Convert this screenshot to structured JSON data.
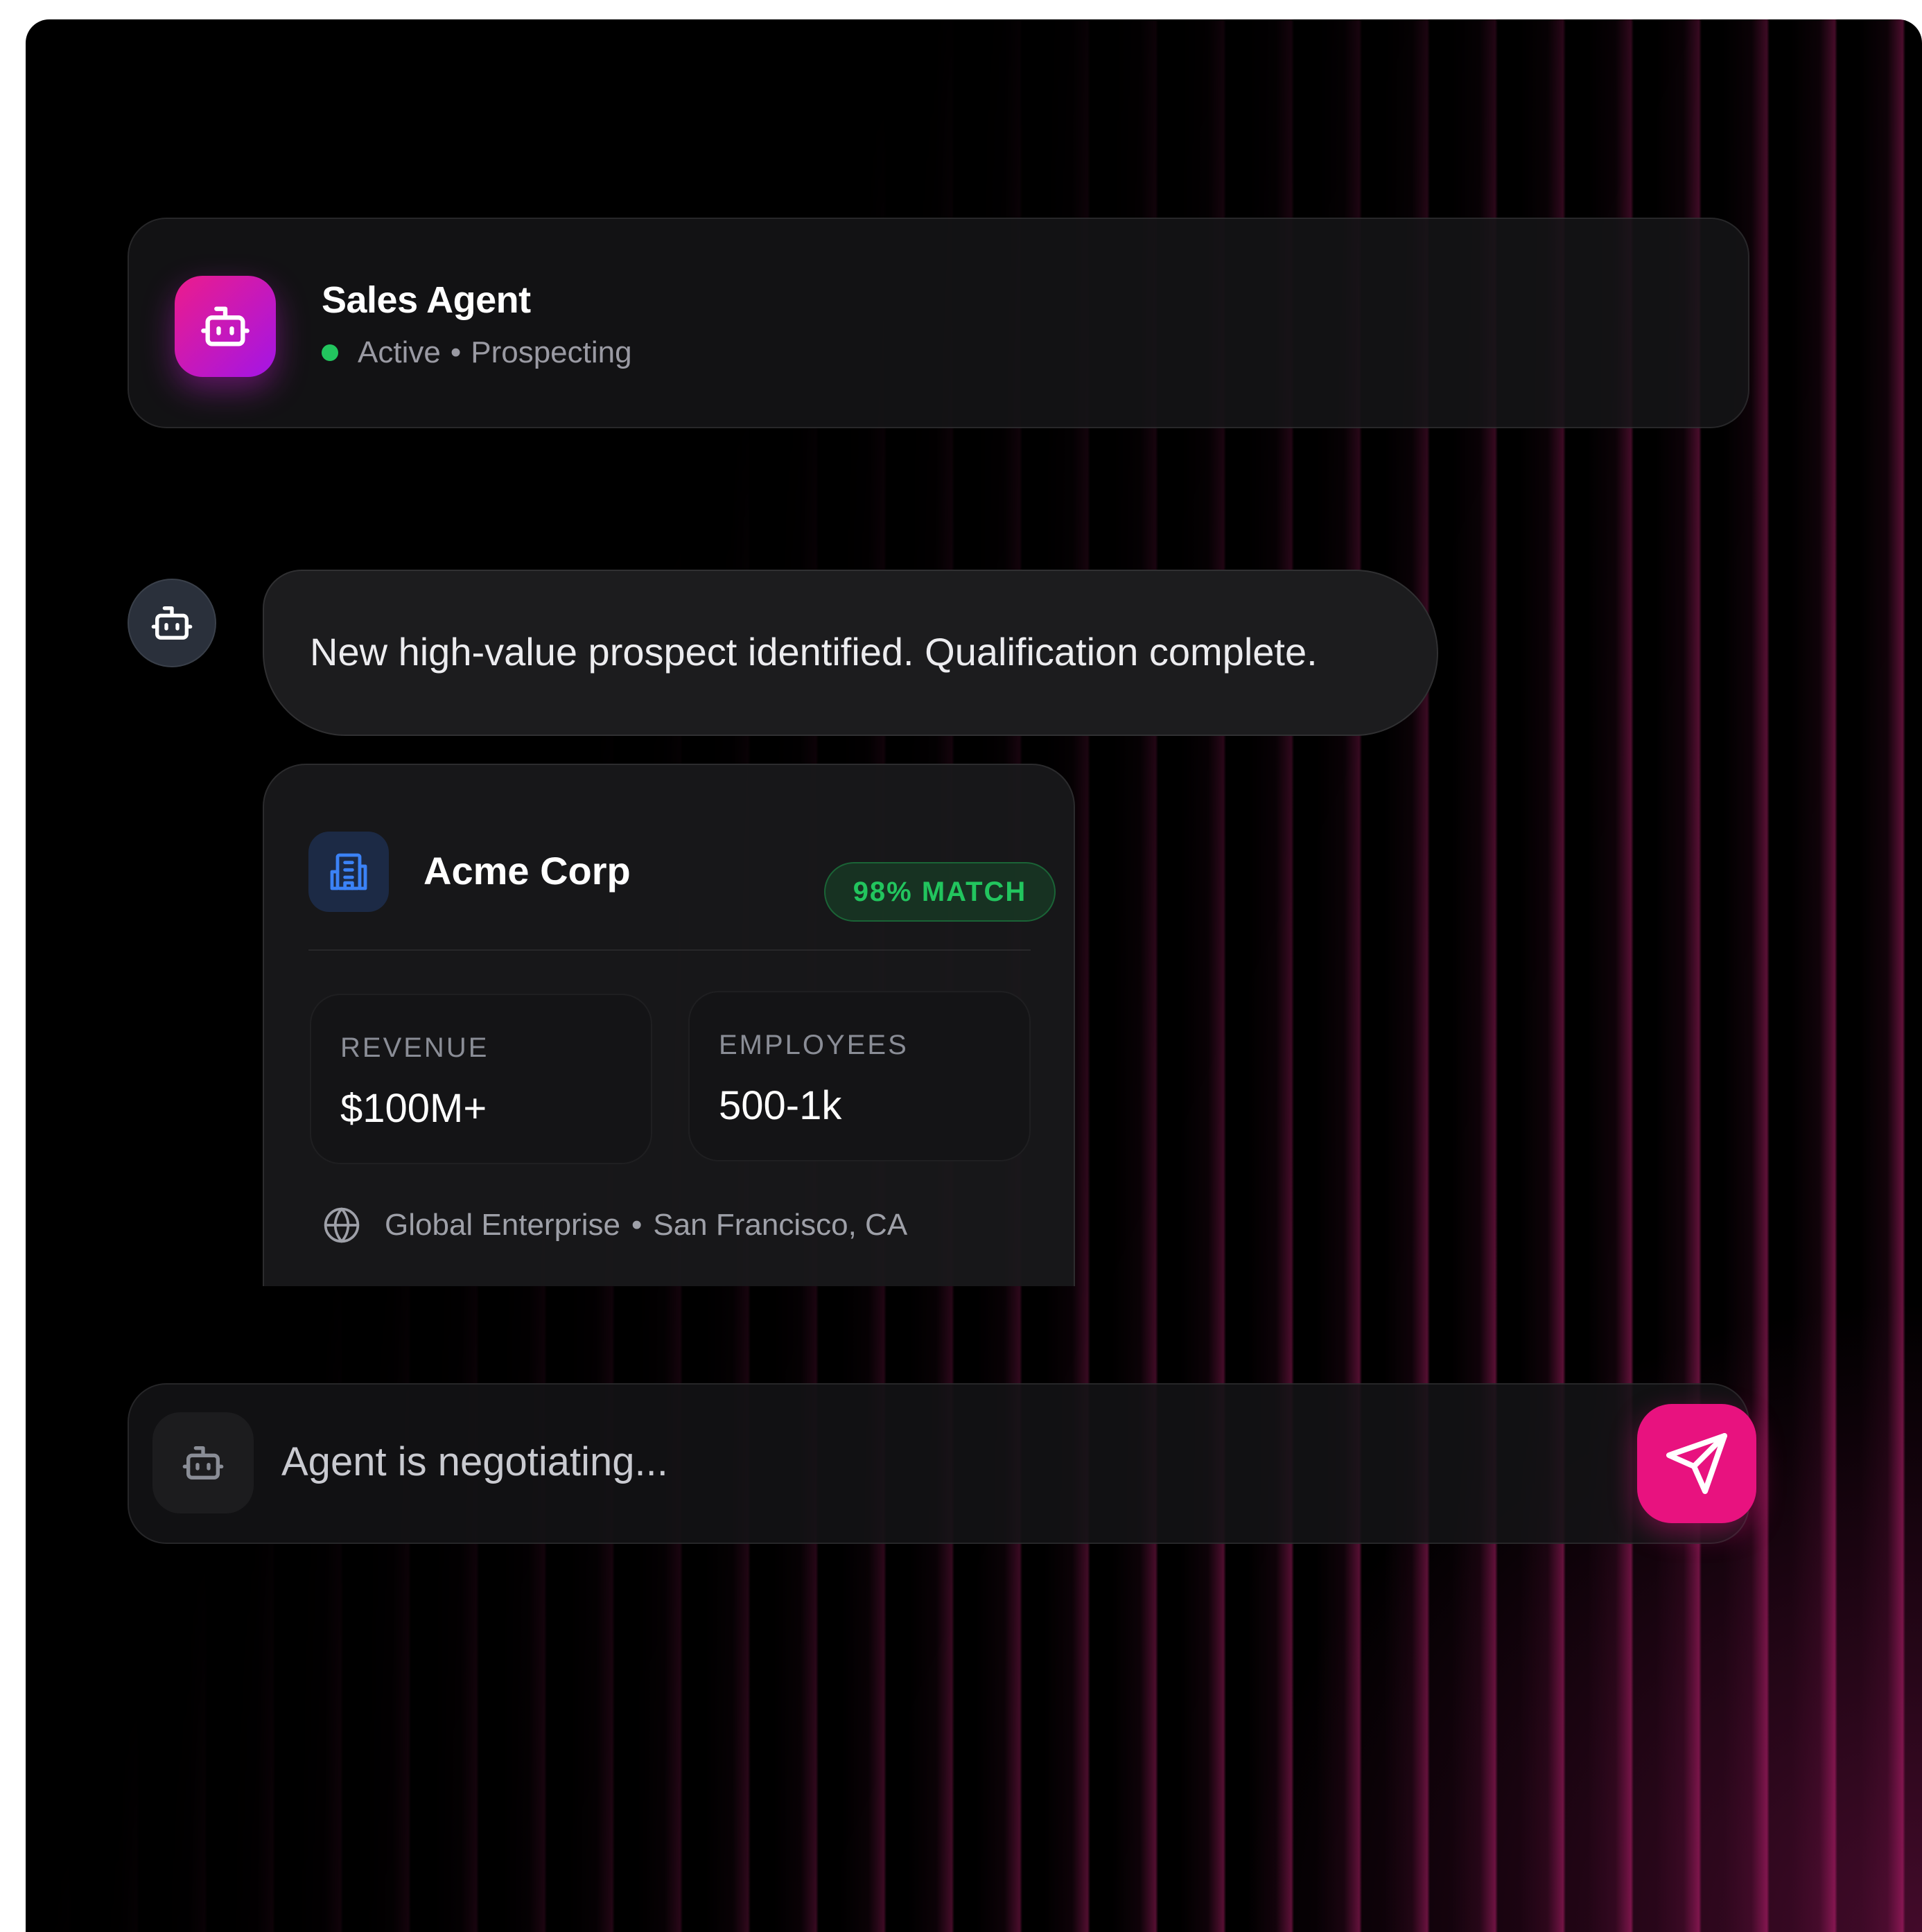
{
  "header": {
    "title": "Sales Agent",
    "status": "Active",
    "separator": "•",
    "mode": "Prospecting",
    "avatar_icon": "robot-icon",
    "status_color": "#22c55e"
  },
  "message": {
    "avatar_icon": "robot-icon",
    "text": "New high-value prospect identified. Qualification complete."
  },
  "prospect": {
    "icon": "building-icon",
    "company": "Acme Corp",
    "match": "98% MATCH",
    "stats": [
      {
        "label": "REVENUE",
        "value": "$100M+"
      },
      {
        "label": "EMPLOYEES",
        "value": "500-1k"
      }
    ],
    "location_icon": "globe-icon",
    "segment": "Global Enterprise",
    "separator": "•",
    "location": "San Francisco, CA"
  },
  "composer": {
    "agent_icon": "robot-icon",
    "placeholder": "Agent is negotiating...",
    "send_icon": "send-icon"
  },
  "colors": {
    "accent": "#e8127f",
    "avatar_gradient_start": "#ec1c8c",
    "avatar_gradient_end": "#a315e6",
    "match_green": "#22c55e",
    "background": "#000000"
  }
}
